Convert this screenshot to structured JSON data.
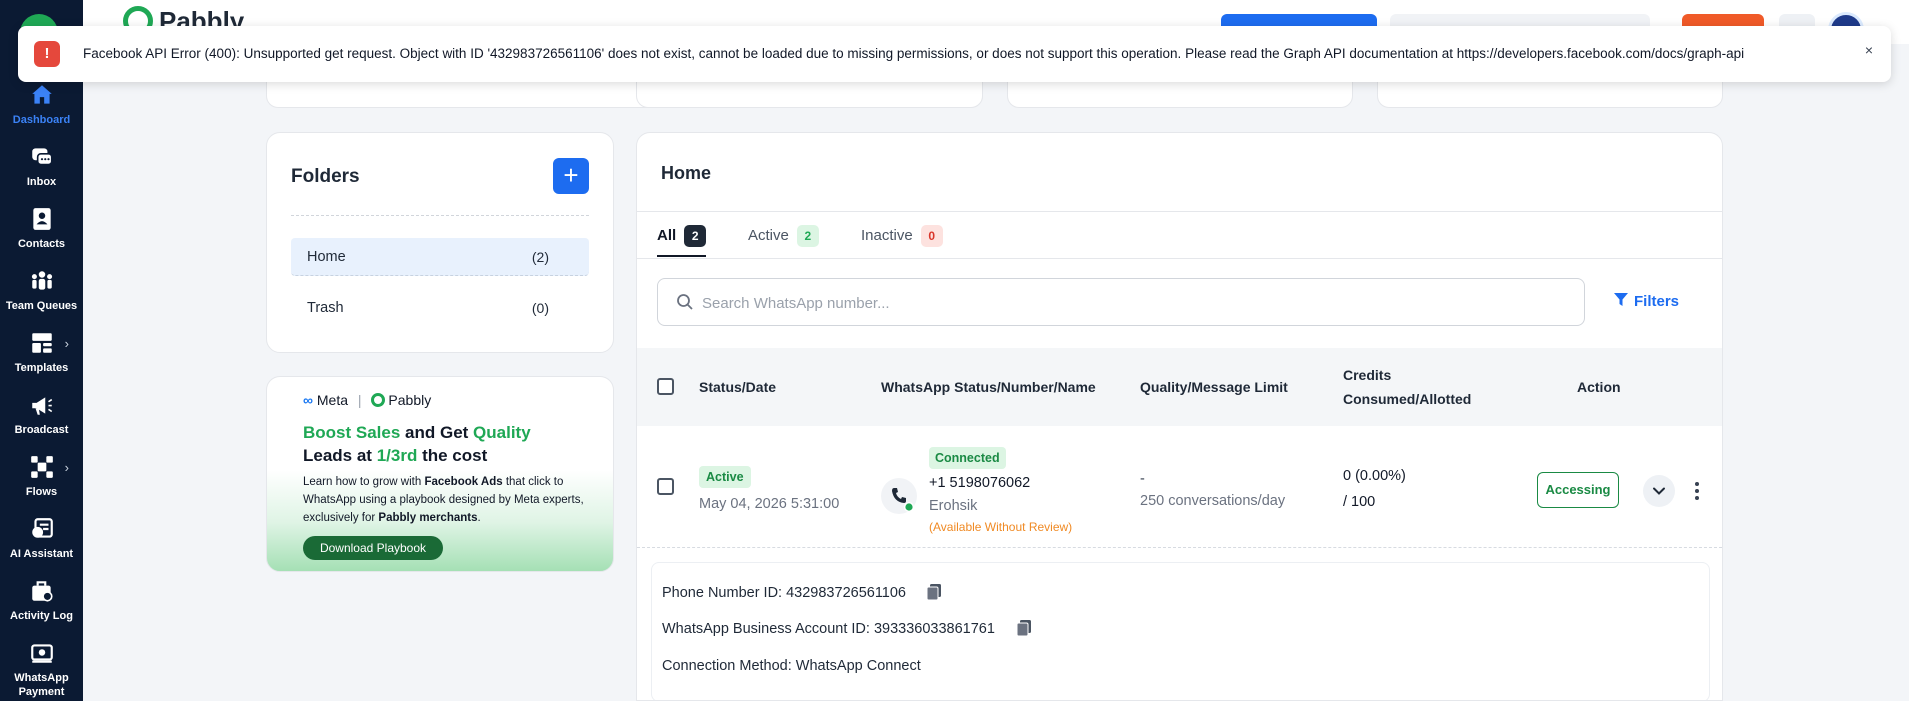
{
  "brand": {
    "name": "Pabbly"
  },
  "sidebar": {
    "items": [
      {
        "label": "Dashboard",
        "icon": "home-icon",
        "active": true
      },
      {
        "label": "Inbox",
        "icon": "chat-icon"
      },
      {
        "label": "Contacts",
        "icon": "contact-card-icon"
      },
      {
        "label": "Team Queues",
        "icon": "team-icon"
      },
      {
        "label": "Templates",
        "icon": "template-icon",
        "expandable": true
      },
      {
        "label": "Broadcast",
        "icon": "megaphone-icon"
      },
      {
        "label": "Flows",
        "icon": "flow-icon",
        "expandable": true
      },
      {
        "label": "AI Assistant",
        "icon": "ai-assistant-icon"
      },
      {
        "label": "Activity Log",
        "icon": "activity-log-icon"
      },
      {
        "label": "WhatsApp",
        "label2": "Payment",
        "icon": "payment-icon"
      }
    ]
  },
  "toast": {
    "message": "Facebook API Error (400): Unsupported get request. Object with ID '432983726561106' does not exist, cannot be loaded due to missing permissions, or does not support this operation. Please read the Graph API documentation at https://developers.facebook.com/docs/graph-api",
    "close": "×",
    "icon": "!"
  },
  "folders": {
    "title": "Folders",
    "add": "+",
    "items": [
      {
        "name": "Home",
        "count": "(2)",
        "selected": true
      },
      {
        "name": "Trash",
        "count": "(0)"
      }
    ]
  },
  "promo": {
    "meta": "Meta",
    "pabbly": "Pabbly",
    "headline": {
      "part1": "Boost Sales",
      "part2": " and Get ",
      "part3": "Quality",
      "part4": "Leads at ",
      "part5": "1/3rd",
      "part6": " the cost"
    },
    "body": {
      "part1": "Learn how to grow with ",
      "part2": "Facebook Ads",
      "part3": " that click to WhatsApp using a playbook designed by Meta experts, exclusively for ",
      "part4": "Pabbly merchants",
      "part5": "."
    },
    "button": "Download Playbook"
  },
  "home": {
    "title": "Home",
    "tabs": [
      {
        "label": "All",
        "count": "2",
        "active": true
      },
      {
        "label": "Active",
        "count": "2"
      },
      {
        "label": "Inactive",
        "count": "0"
      }
    ],
    "search_placeholder": "Search WhatsApp number...",
    "filters_label": "Filters",
    "columns": {
      "status_date": "Status/Date",
      "wa_status": "WhatsApp Status/Number/Name",
      "quality": "Quality/Message Limit",
      "credits_line1": "Credits",
      "credits_line2": "Consumed/Allotted",
      "action": "Action"
    },
    "row": {
      "status": "Active",
      "date": "May 04, 2026 5:31:00",
      "wa_status": "Connected",
      "number": "+1 5198076062",
      "name": "Erohsik",
      "note": "(Available Without Review)",
      "quality": "-",
      "limit": "250 conversations/day",
      "credits_used": "0 (0.00%)",
      "credits_total": "/ 100",
      "action_button": "Accessing"
    },
    "details": {
      "phone_id": "Phone Number ID: 432983726561106",
      "waba_id": "WhatsApp Business Account ID: 393336033861761",
      "method": "Connection Method: WhatsApp Connect"
    }
  },
  "colors": {
    "sidebar_bg": "#0b1a33",
    "primary": "#1d6cf0",
    "success": "#1fa855",
    "danger": "#e5483c",
    "warning": "#f08a24"
  }
}
